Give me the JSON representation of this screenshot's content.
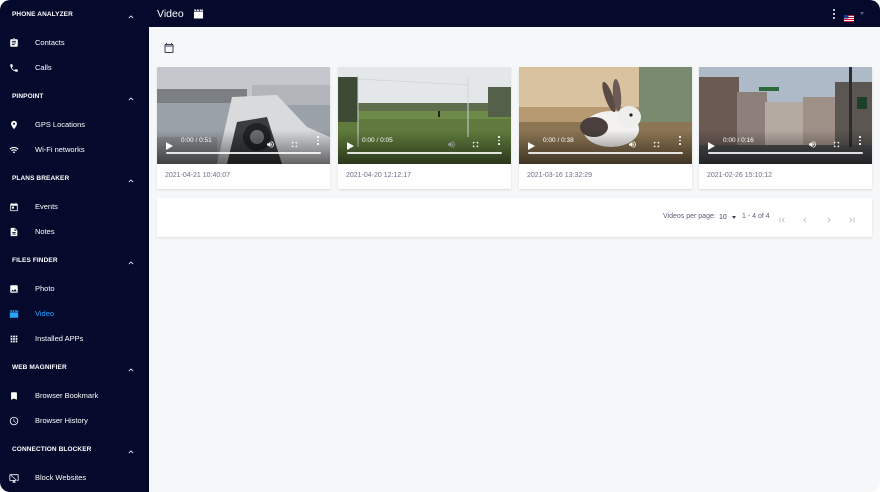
{
  "sidebar": {
    "sections": [
      {
        "title": "PHONE ANALYZER",
        "items": [
          {
            "label": "Contacts",
            "icon": "contacts-icon"
          },
          {
            "label": "Calls",
            "icon": "phone-icon"
          }
        ]
      },
      {
        "title": "PINPOINT",
        "items": [
          {
            "label": "GPS Locations",
            "icon": "location-pin-icon"
          },
          {
            "label": "Wi-Fi networks",
            "icon": "wifi-icon"
          }
        ]
      },
      {
        "title": "PLANS BREAKER",
        "items": [
          {
            "label": "Events",
            "icon": "calendar-icon"
          },
          {
            "label": "Notes",
            "icon": "note-icon"
          }
        ]
      },
      {
        "title": "FILES FINDER",
        "items": [
          {
            "label": "Photo",
            "icon": "photo-icon"
          },
          {
            "label": "Video",
            "icon": "video-clapper-icon",
            "active": true
          },
          {
            "label": "Installed APPs",
            "icon": "apps-grid-icon"
          }
        ]
      },
      {
        "title": "WEB MAGNIFIER",
        "items": [
          {
            "label": "Browser Bookmark",
            "icon": "bookmark-icon"
          },
          {
            "label": "Browser History",
            "icon": "clock-icon"
          }
        ]
      },
      {
        "title": "CONNECTION BLOCKER",
        "items": [
          {
            "label": "Block Websites",
            "icon": "block-screen-icon"
          }
        ]
      }
    ]
  },
  "header": {
    "title": "Video",
    "title_icon": "video-clapper-icon",
    "language": "us-flag-icon"
  },
  "videos": [
    {
      "time": "0:00 / 0:51",
      "date": "2021-04-21 10:40:07",
      "scene": "car-garage"
    },
    {
      "time": "0:00 / 0:05",
      "date": "2021-04-20 12:12:17",
      "scene": "soccer-field"
    },
    {
      "time": "0:00 / 0:38",
      "date": "2021-03-16 13:32:29",
      "scene": "rabbit"
    },
    {
      "time": "0:00 / 0:16",
      "date": "2021-02-26 15:10:12",
      "scene": "city-street"
    }
  ],
  "pagination": {
    "per_page_label": "Videos per page:",
    "per_page_value": "10",
    "range": "1 - 4 of 4"
  },
  "colors": {
    "sidebar_bg": "#050a2c",
    "active": "#29a3ff",
    "content_bg": "#f6f7f9"
  }
}
